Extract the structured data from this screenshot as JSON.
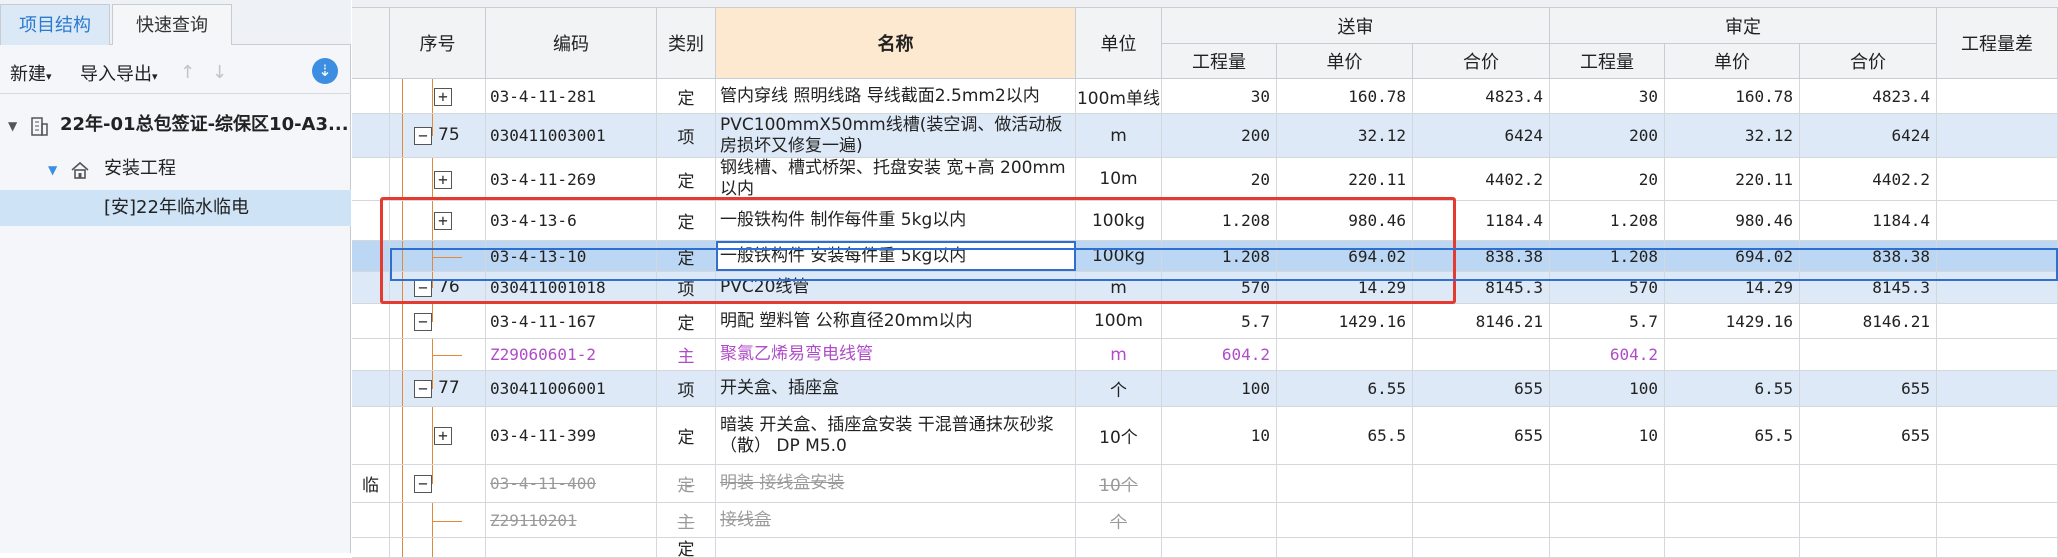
{
  "left_panel": {
    "tabs": [
      {
        "label": "项目结构"
      },
      {
        "label": "快速查询"
      }
    ],
    "toolbar": {
      "new_label": "新建",
      "import_label": "导入导出",
      "up_arrow": "↑",
      "down_arrow": "↓",
      "download_icon": "download-icon"
    },
    "tree": [
      {
        "label": "22年-01总包签证-综保区10-A3..."
      },
      {
        "label": "安装工程"
      },
      {
        "label": "[安]22年临水临电"
      }
    ]
  },
  "grid": {
    "headers": {
      "seq": "序号",
      "code": "编码",
      "type": "类别",
      "name": "名称",
      "unit": "单位",
      "group_submit": "送审",
      "group_approve": "审定",
      "qty": "工程量",
      "price": "单价",
      "total": "合价",
      "diff": "工程量差"
    },
    "rows": [
      {
        "flag": "",
        "seq": "",
        "code": "03-4-11-281",
        "type": "定",
        "name": "管内穿线 照明线路 导线截面2.5mm2以内",
        "unit": "100m单线",
        "s_qty": "30",
        "s_price": "160.78",
        "s_total": "4823.4",
        "a_qty": "30",
        "a_price": "160.78",
        "a_total": "4823.4"
      },
      {
        "flag": "",
        "seq": "75",
        "code": "030411003001",
        "type": "项",
        "name": "PVC100mmX50mm线槽(装空调、做活动板房损坏又修复一遍)",
        "unit": "m",
        "s_qty": "200",
        "s_price": "32.12",
        "s_total": "6424",
        "a_qty": "200",
        "a_price": "32.12",
        "a_total": "6424"
      },
      {
        "flag": "",
        "seq": "",
        "code": "03-4-11-269",
        "type": "定",
        "name": "钢线槽、槽式桥架、托盘安装 宽+高 200mm以内",
        "unit": "10m",
        "s_qty": "20",
        "s_price": "220.11",
        "s_total": "4402.2",
        "a_qty": "20",
        "a_price": "220.11",
        "a_total": "4402.2"
      },
      {
        "flag": "",
        "seq": "",
        "code": "03-4-13-6",
        "type": "定",
        "name": "一般铁构件 制作每件重 5kg以内",
        "unit": "100kg",
        "s_qty": "1.208",
        "s_price": "980.46",
        "s_total": "1184.4",
        "a_qty": "1.208",
        "a_price": "980.46",
        "a_total": "1184.4"
      },
      {
        "flag": "",
        "seq": "",
        "code": "03-4-13-10",
        "type": "定",
        "name": "一般铁构件 安装每件重 5kg以内",
        "unit": "100kg",
        "s_qty": "1.208",
        "s_price": "694.02",
        "s_total": "838.38",
        "a_qty": "1.208",
        "a_price": "694.02",
        "a_total": "838.38"
      },
      {
        "flag": "",
        "seq": "76",
        "code": "030411001018",
        "type": "项",
        "name": "PVC20线管",
        "unit": "m",
        "s_qty": "570",
        "s_price": "14.29",
        "s_total": "8145.3",
        "a_qty": "570",
        "a_price": "14.29",
        "a_total": "8145.3"
      },
      {
        "flag": "",
        "seq": "",
        "code": "03-4-11-167",
        "type": "定",
        "name": "明配 塑料管 公称直径20mm以内",
        "unit": "100m",
        "s_qty": "5.7",
        "s_price": "1429.16",
        "s_total": "8146.21",
        "a_qty": "5.7",
        "a_price": "1429.16",
        "a_total": "8146.21"
      },
      {
        "flag": "",
        "seq": "",
        "code": "Z29060601-2",
        "type": "主",
        "name": "聚氯乙烯易弯电线管",
        "unit": "m",
        "s_qty": "604.2",
        "s_price": "",
        "s_total": "",
        "a_qty": "604.2",
        "a_price": "",
        "a_total": ""
      },
      {
        "flag": "",
        "seq": "77",
        "code": "030411006001",
        "type": "项",
        "name": "开关盒、插座盒",
        "unit": "个",
        "s_qty": "100",
        "s_price": "6.55",
        "s_total": "655",
        "a_qty": "100",
        "a_price": "6.55",
        "a_total": "655"
      },
      {
        "flag": "",
        "seq": "",
        "code": "03-4-11-399",
        "type": "定",
        "name": "暗装 开关盒、插座盒安装 干混普通抹灰砂浆（散） DP M5.0",
        "unit": "10个",
        "s_qty": "10",
        "s_price": "65.5",
        "s_total": "655",
        "a_qty": "10",
        "a_price": "65.5",
        "a_total": "655"
      },
      {
        "flag": "临",
        "seq": "",
        "code": "03-4-11-400",
        "type": "定",
        "name": "明装 接线盒安装",
        "unit": "10个",
        "s_qty": "",
        "s_price": "",
        "s_total": "",
        "a_qty": "",
        "a_price": "",
        "a_total": ""
      },
      {
        "flag": "",
        "seq": "",
        "code": "Z29110201",
        "type": "主",
        "name": "接线盒",
        "unit": "个",
        "s_qty": "",
        "s_price": "",
        "s_total": "",
        "a_qty": "",
        "a_price": "",
        "a_total": ""
      },
      {
        "flag": "",
        "seq": "",
        "code": "",
        "type": "定",
        "name": "",
        "unit": "",
        "s_qty": "",
        "s_price": "",
        "s_total": "",
        "a_qty": "",
        "a_price": "",
        "a_total": ""
      }
    ]
  },
  "colors": {
    "highlight_box": "#e53a2f",
    "selection": "#2f6fd0",
    "item_row": "#dde9f7",
    "main_material": "#b04cc9"
  }
}
